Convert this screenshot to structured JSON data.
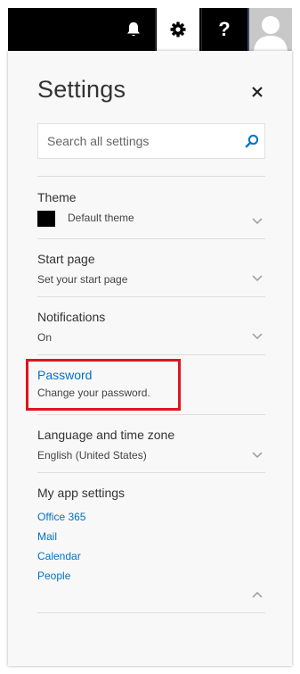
{
  "topbar": {
    "icons": [
      "bell-icon",
      "gear-icon",
      "help-icon",
      "user-avatar"
    ],
    "help_glyph": "?"
  },
  "settings": {
    "title": "Settings",
    "close_icon": "close-icon",
    "search": {
      "placeholder": "Search all settings",
      "value": "",
      "icon": "search-icon"
    }
  },
  "sections": {
    "theme": {
      "title": "Theme",
      "subtitle": "Default theme"
    },
    "start_page": {
      "title": "Start page",
      "subtitle": "Set your start page"
    },
    "notifications": {
      "title": "Notifications",
      "subtitle": "On"
    },
    "password": {
      "title": "Password",
      "subtitle": "Change your password."
    },
    "language": {
      "title": "Language and time zone",
      "subtitle": "English (United States)"
    },
    "my_app_settings": {
      "title": "My app settings",
      "links": [
        "Office 365",
        "Mail",
        "Calendar",
        "People"
      ]
    }
  },
  "colors": {
    "topbar_bg": "#000000",
    "panel_bg": "#f8f8f8",
    "link": "#0072c6",
    "highlight": "#e0141e"
  }
}
